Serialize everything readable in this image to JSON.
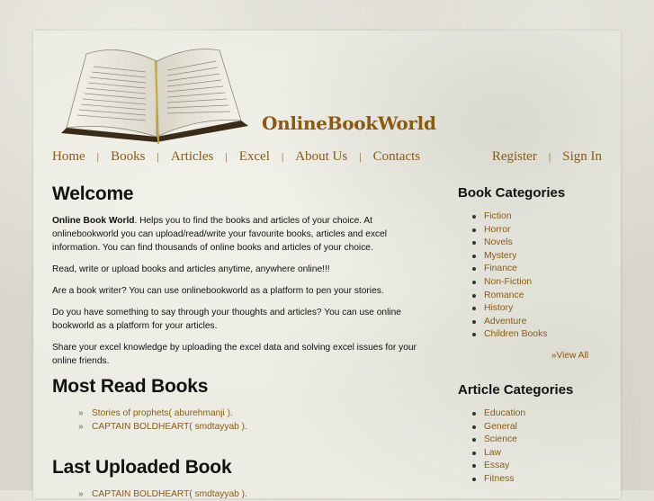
{
  "site": {
    "title": "OnlineBookWorld"
  },
  "colors": {
    "accent": "#8a5a14",
    "page_bg": "#d8d6cc",
    "paper_bg": "#ecece4",
    "text": "#111111"
  },
  "nav": {
    "left": [
      {
        "label": "Home"
      },
      {
        "label": "Books"
      },
      {
        "label": "Articles"
      },
      {
        "label": "Excel"
      },
      {
        "label": "About Us"
      },
      {
        "label": "Contacts"
      }
    ],
    "right": [
      {
        "label": "Register"
      },
      {
        "label": "Sign In"
      }
    ],
    "separator": "|"
  },
  "welcome": {
    "heading": "Welcome",
    "intro_bold": "Online Book World",
    "intro_rest": ". Helps you to find the books and articles of your choice. At onlinebookworld you can upload/read/write your favourite books, articles and excel information. You can find thousands of online books and articles of your choice.",
    "paragraphs": [
      "Read, write or upload books and articles anytime, anywhere online!!!",
      "Are a book writer? You can use onlinebookworld as a platform to pen your stories.",
      "Do you have something to say through your thoughts and articles? You can use online bookworld as a platform for your articles.",
      "Share your excel knowledge by uploading the excel data and solving excel issues for your online friends."
    ]
  },
  "most_read": {
    "heading": "Most Read Books",
    "items": [
      {
        "text": "Stories of prophets( aburehmanji )."
      },
      {
        "text": "CAPTAIN BOLDHEART( smdtayyab )."
      }
    ]
  },
  "last_uploaded": {
    "heading": "Last Uploaded Book",
    "items": [
      {
        "text": "CAPTAIN BOLDHEART( smdtayyab )."
      }
    ]
  },
  "list_marker": "»",
  "book_categories": {
    "heading": "Book Categories",
    "items": [
      "Fiction",
      "Horror",
      "Novels",
      "Mystery",
      "Finance",
      "Non-Fiction",
      "Romance",
      "History",
      "Adventure",
      "Children Books"
    ],
    "view_all": "»View All"
  },
  "article_categories": {
    "heading": "Article Categories",
    "items": [
      "Education",
      "General",
      "Science",
      "Law",
      "Essay",
      "Fitness"
    ]
  },
  "icons": {
    "logo": "open-book-icon"
  }
}
